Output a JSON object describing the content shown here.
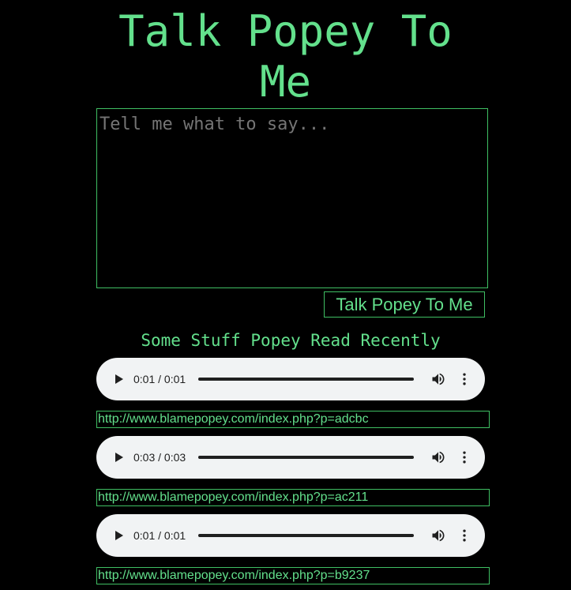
{
  "header": {
    "title_line1": "Talk Popey To",
    "title_line2": "Me"
  },
  "composer": {
    "placeholder": "Tell me what to say...",
    "value": "",
    "submit_label": "Talk Popey To Me"
  },
  "recent": {
    "heading": "Some Stuff Popey Read Recently",
    "items": [
      {
        "time": "0:01 / 0:01",
        "url": "http://www.blamepopey.com/index.php?p=adcbc"
      },
      {
        "time": "0:03 / 0:03",
        "url": "http://www.blamepopey.com/index.php?p=ac211"
      },
      {
        "time": "0:01 / 0:01",
        "url": "http://www.blamepopey.com/index.php?p=b9237"
      }
    ]
  },
  "icons": {
    "play": "play-icon",
    "volume": "volume-icon",
    "more": "more-vert-icon"
  },
  "colors": {
    "background": "#000000",
    "accent": "#63e08c",
    "border": "#3fbf63",
    "player_bg": "#f1f3f4",
    "player_fg": "#1f1f1f",
    "placeholder": "#757575"
  }
}
